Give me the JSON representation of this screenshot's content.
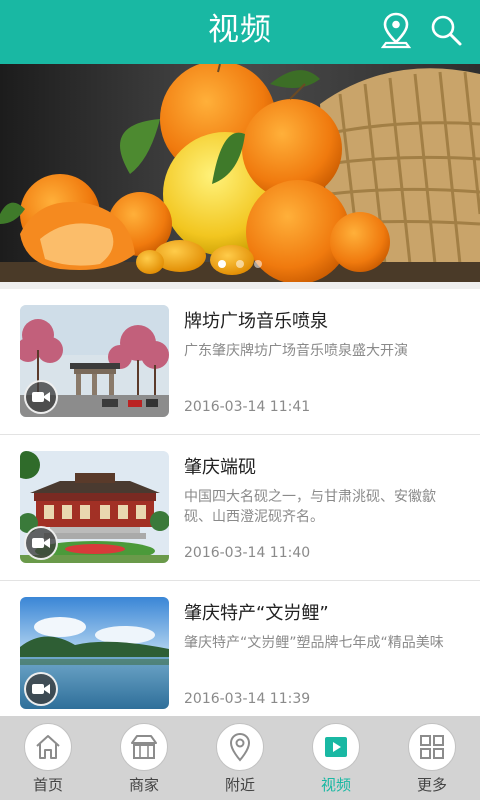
{
  "header": {
    "title": "视频",
    "location_icon": "location-pin-icon",
    "search_icon": "search-icon"
  },
  "banner": {
    "slides": 3,
    "active_slide": 1
  },
  "videos": [
    {
      "title": "牌坊广场音乐喷泉",
      "description": "广东肇庆牌坊广场音乐喷泉盛大开演",
      "date": "2016-03-14 11:41"
    },
    {
      "title": "肇庆端砚",
      "description": "中国四大名砚之一，与甘肃洮砚、安徽歙砚、山西澄泥砚齐名。",
      "date": "2016-03-14 11:40"
    },
    {
      "title": "肇庆特产“文岃鲤”",
      "description": "肇庆特产“文岃鲤”塑品牌七年成“精品美味",
      "date": "2016-03-14 11:39"
    }
  ],
  "nav": {
    "items": [
      {
        "label": "首页",
        "icon": "home-icon"
      },
      {
        "label": "商家",
        "icon": "store-icon"
      },
      {
        "label": "附近",
        "icon": "location-icon"
      },
      {
        "label": "视频",
        "icon": "video-play-icon"
      },
      {
        "label": "更多",
        "icon": "grid-icon"
      }
    ],
    "active_index": 3
  },
  "colors": {
    "primary": "#19b8a3",
    "nav_background": "#d3d3d3",
    "text_secondary": "#8a8a8a"
  }
}
